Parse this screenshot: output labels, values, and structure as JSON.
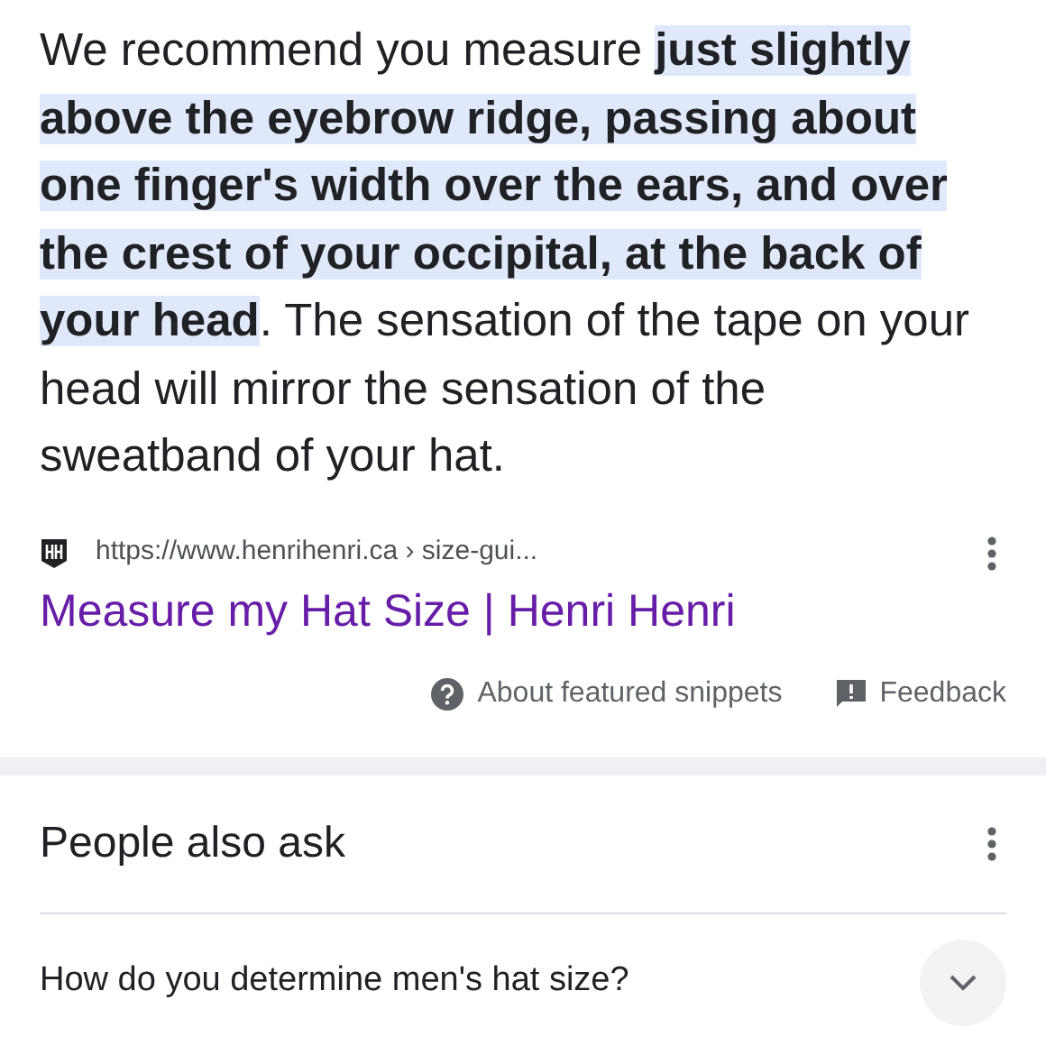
{
  "snippet": {
    "segments": [
      {
        "text": "We recommend you measure ",
        "highlighted": false
      },
      {
        "text": "just slightly above the eyebrow ridge, passing about one finger's width over the ears, and over the crest of your occipital, at the back of your head",
        "highlighted": true
      },
      {
        "text": ". The sensation of the tape on your head will mirror the sensation of the sweatband of your hat.",
        "highlighted": false
      }
    ]
  },
  "source": {
    "url": "https://www.henrihenri.ca › size-gui...",
    "title": "Measure my Hat Size | Henri Henri"
  },
  "footer_links": [
    "About featured snippets",
    "Feedback"
  ],
  "people_also_ask": {
    "heading": "People also ask",
    "questions": [
      {
        "text": "How do you determine men's hat size?",
        "expanded": false
      }
    ]
  }
}
